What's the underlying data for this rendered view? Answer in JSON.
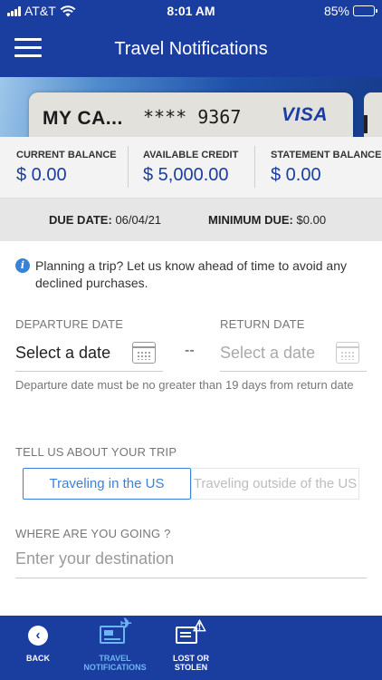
{
  "status_bar": {
    "carrier": "AT&T",
    "time": "8:01 AM",
    "battery_percent": "85%",
    "battery_level": 0.85
  },
  "header": {
    "title": "Travel Notifications",
    "menu_icon": "hamburger-menu-icon"
  },
  "card": {
    "name": "MY CA...",
    "number": "**** 9367",
    "network": "VISA"
  },
  "balance": {
    "current_label": "CURRENT BALANCE",
    "current_value": "$ 0.00",
    "available_label": "AVAILABLE CREDIT",
    "available_value": "$ 5,000.00",
    "statement_label": "STATEMENT BALANCE",
    "statement_value": "$ 0.00"
  },
  "due": {
    "due_label": "DUE DATE:",
    "due_value": "06/04/21",
    "min_label": "MINIMUM DUE:",
    "min_value": "$0.00"
  },
  "info": {
    "icon": "info-icon",
    "text": "Planning a trip? Let us know ahead of time to avoid any declined purchases."
  },
  "form": {
    "departure_label": "DEPARTURE DATE",
    "departure_value": "Select a date",
    "separator": "--",
    "return_label": "RETURN DATE",
    "return_value": "Select a date",
    "hint": "Departure date must be no greater than 19 days from return date",
    "trip_label": "TELL US ABOUT YOUR TRIP",
    "trip_options": [
      "Traveling in the US",
      "Traveling outside of the US"
    ],
    "trip_selected": "Traveling in the US",
    "destination_label": "WHERE ARE YOU GOING ?",
    "destination_placeholder": "Enter your destination",
    "destination_value": ""
  },
  "bottom_nav": {
    "back": "BACK",
    "travel_line1": "TRAVEL",
    "travel_line2": "NOTIFICATIONS",
    "lost_line1": "LOST OR",
    "lost_line2": "STOLEN"
  },
  "colors": {
    "brand_blue": "#1a3da0",
    "accent_blue": "#3b82d6",
    "active_nav": "#6fb4f2"
  }
}
